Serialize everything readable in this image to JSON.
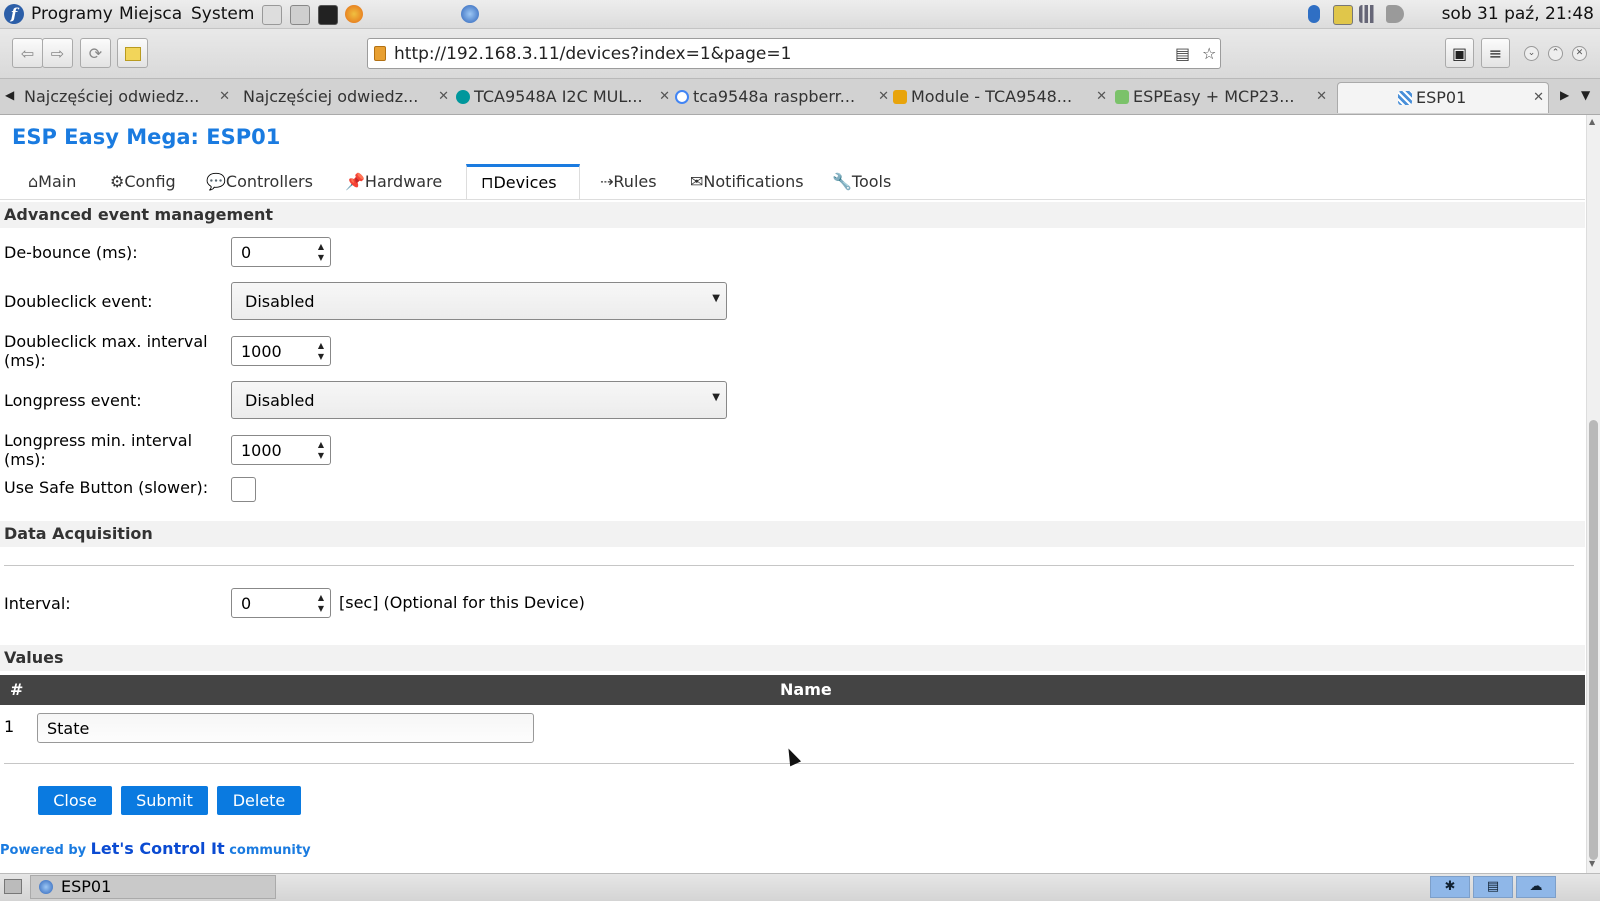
{
  "system_panel": {
    "menus": [
      "Programy",
      "Miejsca",
      "System"
    ],
    "clock": "sob 31 paź, 21:48"
  },
  "browser": {
    "url": "http://192.168.3.11/devices?index=1&page=1",
    "tabs": [
      {
        "title": "Najczęściej odwiedz...",
        "icon": "none",
        "active": false
      },
      {
        "title": "Najczęściej odwiedz...",
        "icon": "none",
        "active": false
      },
      {
        "title": "TCA9548A I2C MUL...",
        "icon": "arduino-icon",
        "active": false
      },
      {
        "title": "tca9548a raspberr...",
        "icon": "google-icon",
        "active": false
      },
      {
        "title": "Module - TCA9548...",
        "icon": "module-icon",
        "active": false
      },
      {
        "title": "ESPEasy + MCP23...",
        "icon": "home-icon",
        "active": false
      },
      {
        "title": "ESP01",
        "icon": "esp-icon",
        "active": true
      }
    ]
  },
  "page": {
    "title": "ESP Easy Mega: ESP01",
    "menu": [
      {
        "label": "⌂Main",
        "active": false
      },
      {
        "label": "⚙Config",
        "active": false
      },
      {
        "label": "💬Controllers",
        "active": false
      },
      {
        "label": "📌Hardware",
        "active": false
      },
      {
        "label": "⊓Devices",
        "active": true
      },
      {
        "label": "⇢Rules",
        "active": false
      },
      {
        "label": "✉Notifications",
        "active": false
      },
      {
        "label": "🔧Tools",
        "active": false
      }
    ],
    "advanced": {
      "header": "Advanced event management",
      "debounce_label": "De-bounce (ms):",
      "debounce_value": "0",
      "doubleclick_label": "Doubleclick event:",
      "doubleclick_value": "Disabled",
      "doubleclick_interval_label": "Doubleclick max. interval (ms):",
      "doubleclick_interval_value": "1000",
      "longpress_label": "Longpress event:",
      "longpress_value": "Disabled",
      "longpress_interval_label": "Longpress min. interval (ms):",
      "longpress_interval_value": "1000",
      "safe_button_label": "Use Safe Button (slower):",
      "safe_button_checked": false
    },
    "data_acquisition": {
      "header": "Data Acquisition",
      "interval_label": "Interval:",
      "interval_value": "0",
      "interval_note": "[sec] (Optional for this Device)"
    },
    "values": {
      "header": "Values",
      "columns": [
        "#",
        "Name"
      ],
      "rows": [
        {
          "num": "1",
          "name": "State"
        }
      ]
    },
    "buttons": {
      "close": "Close",
      "submit": "Submit",
      "delete": "Delete"
    },
    "footer": {
      "prefix": "Powered by",
      "brand": "Let's Control It",
      "suffix": "community"
    }
  },
  "taskbar": {
    "window_title": "ESP01"
  },
  "colors": {
    "accent": "#1a7be0",
    "button": "#0a7ae0",
    "table_header": "#444444"
  }
}
